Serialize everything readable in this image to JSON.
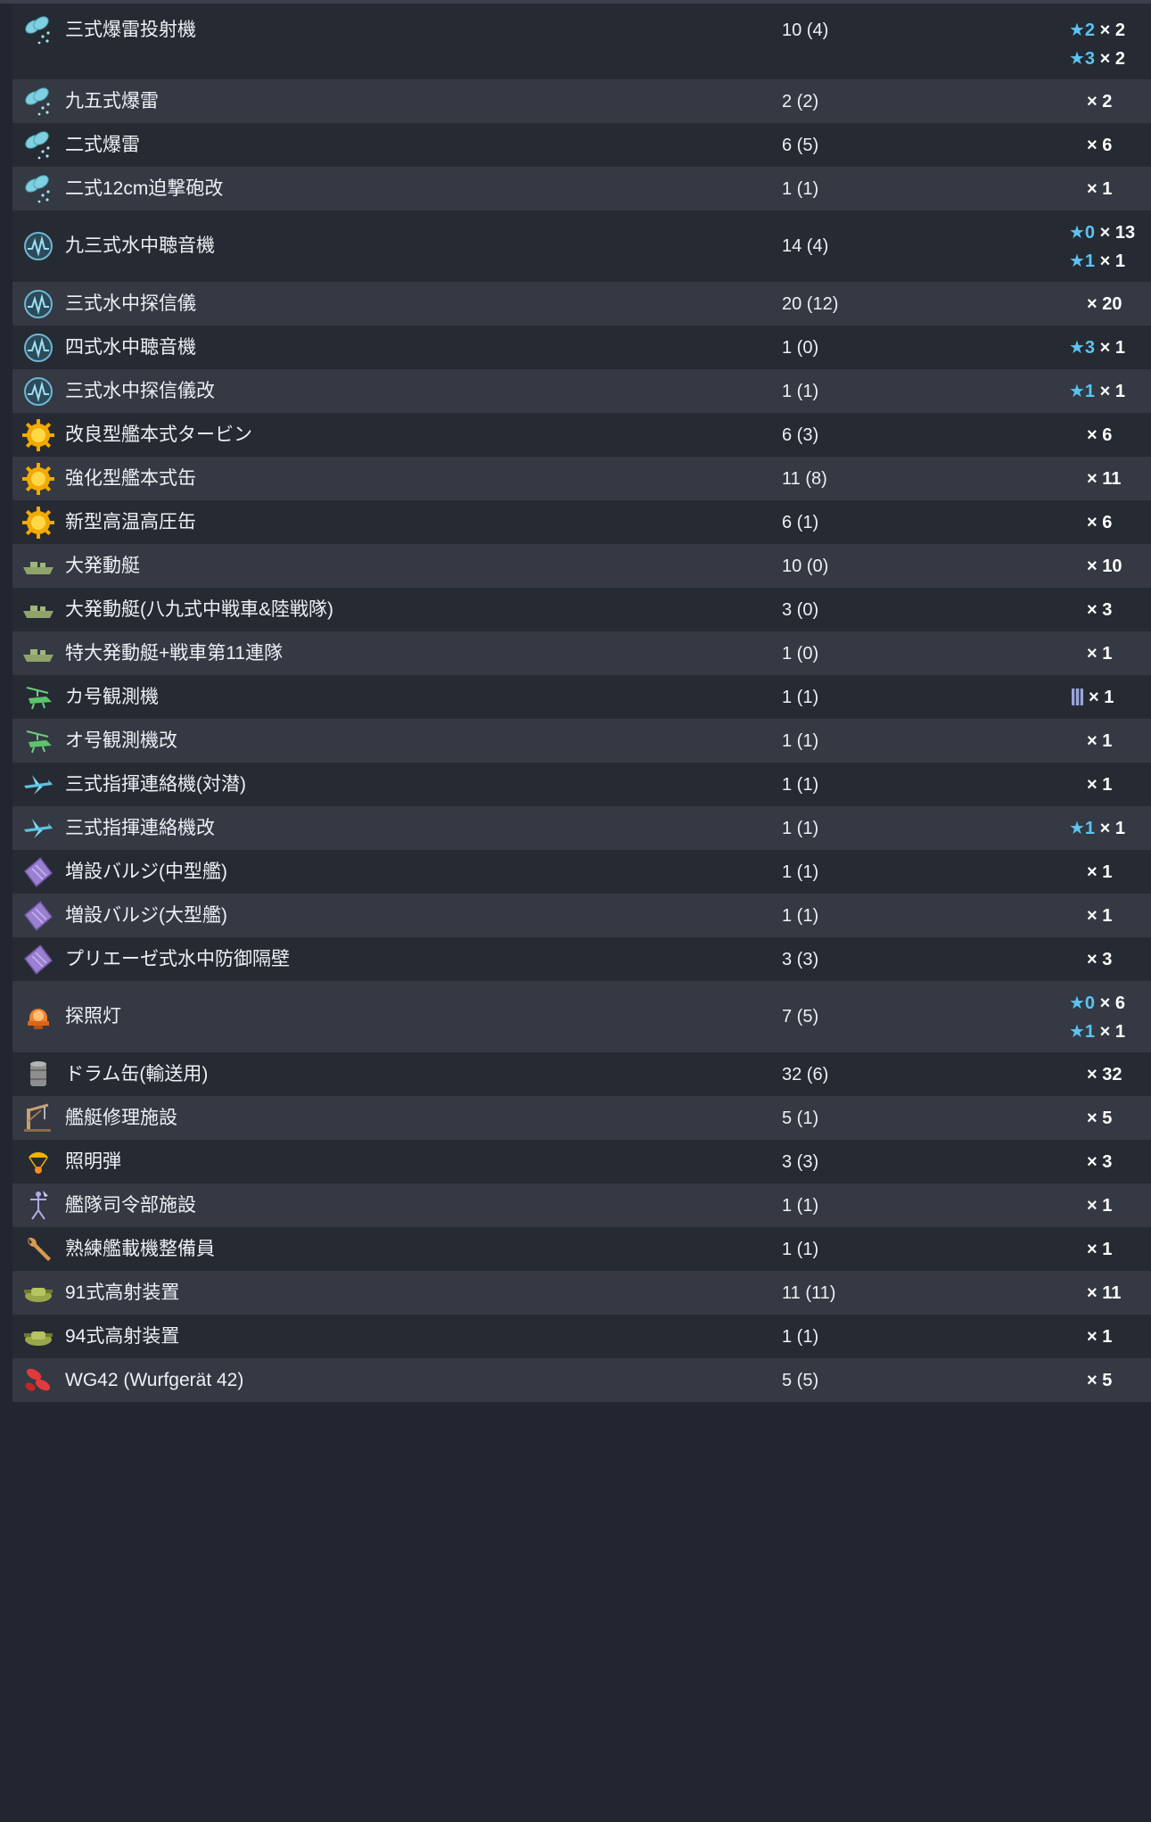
{
  "equipment": [
    {
      "name": "三式爆雷投射機",
      "count": "10 (4)",
      "icon": "depth-charge-icon",
      "improvements": [
        {
          "star": "★2",
          "qty": "× 2"
        },
        {
          "star": "★3",
          "qty": "× 2"
        }
      ]
    },
    {
      "name": "九五式爆雷",
      "count": "2 (2)",
      "icon": "depth-charge-icon",
      "improvements": [
        {
          "star": "",
          "qty": "× 2"
        }
      ]
    },
    {
      "name": "二式爆雷",
      "count": "6 (5)",
      "icon": "depth-charge-icon",
      "improvements": [
        {
          "star": "",
          "qty": "× 6"
        }
      ]
    },
    {
      "name": "二式12cm迫撃砲改",
      "count": "1 (1)",
      "icon": "depth-charge-icon",
      "improvements": [
        {
          "star": "",
          "qty": "× 1"
        }
      ]
    },
    {
      "name": "九三式水中聴音機",
      "count": "14 (4)",
      "icon": "sonar-icon",
      "improvements": [
        {
          "star": "★0",
          "qty": "× 13"
        },
        {
          "star": "★1",
          "qty": "× 1"
        }
      ]
    },
    {
      "name": "三式水中探信儀",
      "count": "20 (12)",
      "icon": "sonar-icon",
      "improvements": [
        {
          "star": "",
          "qty": "× 20"
        }
      ]
    },
    {
      "name": "四式水中聴音機",
      "count": "1 (0)",
      "icon": "sonar-icon",
      "improvements": [
        {
          "star": "★3",
          "qty": "× 1"
        }
      ]
    },
    {
      "name": "三式水中探信儀改",
      "count": "1 (1)",
      "icon": "sonar-icon",
      "improvements": [
        {
          "star": "★1",
          "qty": "× 1"
        }
      ]
    },
    {
      "name": "改良型艦本式タービン",
      "count": "6 (3)",
      "icon": "engine-icon",
      "improvements": [
        {
          "star": "",
          "qty": "× 6"
        }
      ]
    },
    {
      "name": "強化型艦本式缶",
      "count": "11 (8)",
      "icon": "engine-icon",
      "improvements": [
        {
          "star": "",
          "qty": "× 11"
        }
      ]
    },
    {
      "name": "新型高温高圧缶",
      "count": "6 (1)",
      "icon": "engine-icon",
      "improvements": [
        {
          "star": "",
          "qty": "× 6"
        }
      ]
    },
    {
      "name": "大発動艇",
      "count": "10 (0)",
      "icon": "landing-craft-icon",
      "improvements": [
        {
          "star": "",
          "qty": "× 10"
        }
      ]
    },
    {
      "name": "大発動艇(八九式中戦車&陸戦隊)",
      "count": "3 (0)",
      "icon": "landing-craft-icon",
      "improvements": [
        {
          "star": "",
          "qty": "× 3"
        }
      ]
    },
    {
      "name": "特大発動艇+戦車第11連隊",
      "count": "1 (0)",
      "icon": "landing-craft-icon",
      "improvements": [
        {
          "star": "",
          "qty": "× 1"
        }
      ]
    },
    {
      "name": "カ号観測機",
      "count": "1 (1)",
      "icon": "autogyro-icon",
      "improvements": [
        {
          "star": "",
          "qty": "× 1",
          "proficiency": true
        }
      ]
    },
    {
      "name": "オ号観測機改",
      "count": "1 (1)",
      "icon": "autogyro-icon",
      "improvements": [
        {
          "star": "",
          "qty": "× 1"
        }
      ]
    },
    {
      "name": "三式指揮連絡機(対潜)",
      "count": "1 (1)",
      "icon": "liaison-plane-icon",
      "improvements": [
        {
          "star": "",
          "qty": "× 1"
        }
      ]
    },
    {
      "name": "三式指揮連絡機改",
      "count": "1 (1)",
      "icon": "liaison-plane-icon",
      "improvements": [
        {
          "star": "★1",
          "qty": "× 1"
        }
      ]
    },
    {
      "name": "増設バルジ(中型艦)",
      "count": "1 (1)",
      "icon": "bulge-icon",
      "improvements": [
        {
          "star": "",
          "qty": "× 1"
        }
      ]
    },
    {
      "name": "増設バルジ(大型艦)",
      "count": "1 (1)",
      "icon": "bulge-icon",
      "improvements": [
        {
          "star": "",
          "qty": "× 1"
        }
      ]
    },
    {
      "name": "プリエーゼ式水中防御隔壁",
      "count": "3 (3)",
      "icon": "bulge-icon",
      "improvements": [
        {
          "star": "",
          "qty": "× 3"
        }
      ]
    },
    {
      "name": "探照灯",
      "count": "7 (5)",
      "icon": "searchlight-icon",
      "improvements": [
        {
          "star": "★0",
          "qty": "× 6"
        },
        {
          "star": "★1",
          "qty": "× 1"
        }
      ]
    },
    {
      "name": "ドラム缶(輸送用)",
      "count": "32 (6)",
      "icon": "drum-can-icon",
      "improvements": [
        {
          "star": "",
          "qty": "× 32"
        }
      ]
    },
    {
      "name": "艦艇修理施設",
      "count": "5 (1)",
      "icon": "repair-crane-icon",
      "improvements": [
        {
          "star": "",
          "qty": "× 5"
        }
      ]
    },
    {
      "name": "照明弾",
      "count": "3 (3)",
      "icon": "star-shell-icon",
      "improvements": [
        {
          "star": "",
          "qty": "× 3"
        }
      ]
    },
    {
      "name": "艦隊司令部施設",
      "count": "1 (1)",
      "icon": "fleet-command-icon",
      "improvements": [
        {
          "star": "",
          "qty": "× 1"
        }
      ]
    },
    {
      "name": "熟練艦載機整備員",
      "count": "1 (1)",
      "icon": "wrench-icon",
      "improvements": [
        {
          "star": "",
          "qty": "× 1"
        }
      ]
    },
    {
      "name": "91式高射装置",
      "count": "11 (11)",
      "icon": "aa-director-icon",
      "improvements": [
        {
          "star": "",
          "qty": "× 11"
        }
      ]
    },
    {
      "name": "94式高射装置",
      "count": "1 (1)",
      "icon": "aa-director-icon",
      "improvements": [
        {
          "star": "",
          "qty": "× 1"
        }
      ]
    },
    {
      "name": "WG42 (Wurfgerät 42)",
      "count": "5 (5)",
      "icon": "rocket-launcher-icon",
      "improvements": [
        {
          "star": "",
          "qty": "× 5"
        }
      ]
    }
  ],
  "colors": {
    "star": "#5cc3f0",
    "row_dark": "#262a33",
    "row_light": "#343944",
    "background": "#222630"
  }
}
